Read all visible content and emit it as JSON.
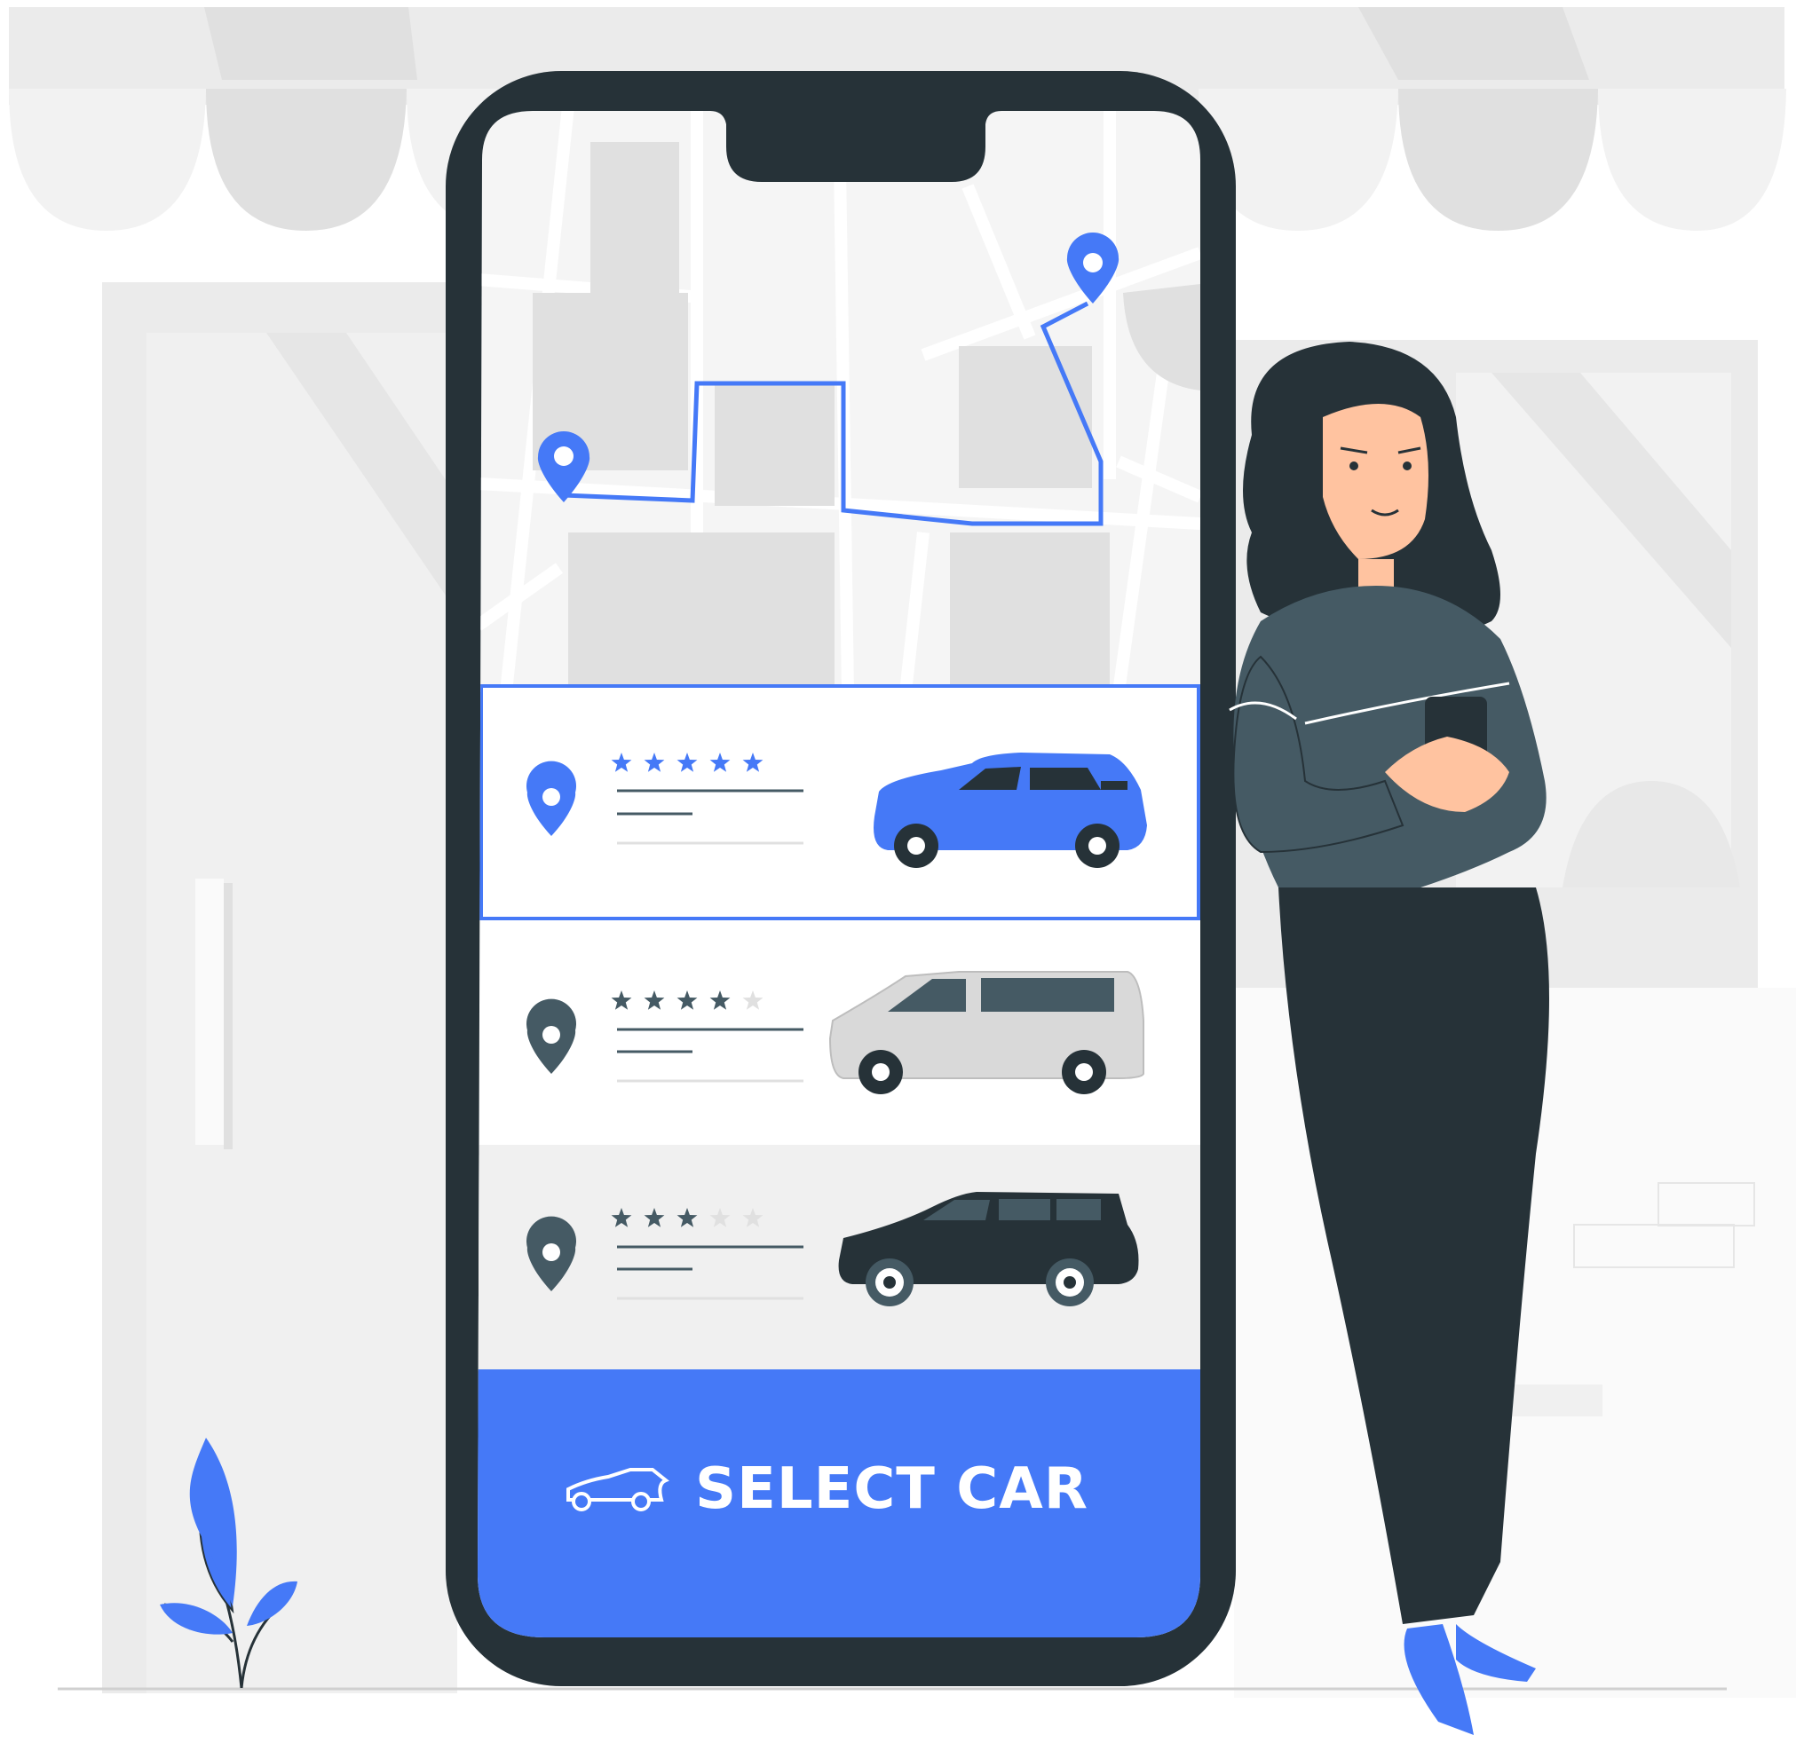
{
  "screen": {
    "select_button_label": "SELECT CAR",
    "map": {
      "route_points": 2
    },
    "cars": [
      {
        "type": "hatchback",
        "rating": 5,
        "max_rating": 5,
        "color": "#4579F7",
        "selected": true
      },
      {
        "type": "van",
        "rating": 4,
        "max_rating": 5,
        "color": "#D9D9D9",
        "selected": false
      },
      {
        "type": "suv",
        "rating": 3,
        "max_rating": 5,
        "color": "#263238",
        "selected": false
      }
    ]
  },
  "colors": {
    "accent": "#4579F7",
    "phone_frame": "#263238",
    "background_gray": "#EBEBEB",
    "star_filled": "#455A64",
    "star_empty": "#E0E0E0"
  },
  "icons": [
    "location-pin-icon",
    "star-icon",
    "car-outline-icon",
    "route-icon"
  ]
}
